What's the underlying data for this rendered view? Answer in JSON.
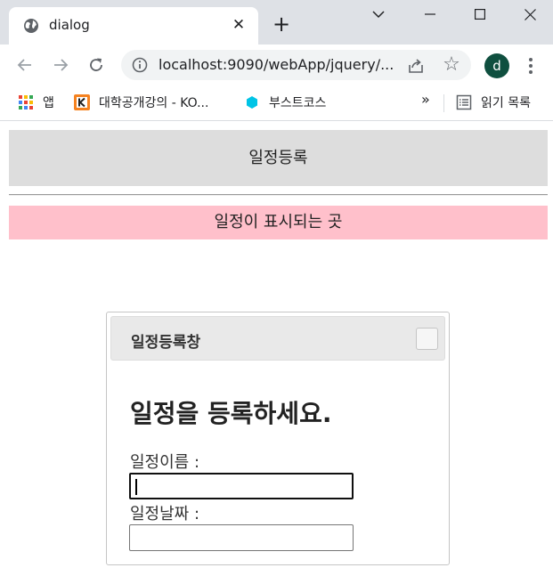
{
  "browser": {
    "tab_title": "dialog",
    "tab_close": "✕",
    "new_tab": "+",
    "url": "localhost:9090/webApp/jquery/...",
    "profile_initial": "d",
    "bookmarks": [
      {
        "label": "앱"
      },
      {
        "label": "대학공개강의 - KO..."
      },
      {
        "label": "부스트코스"
      }
    ],
    "bookmarks_more": "»",
    "reading_list": "읽기 목록"
  },
  "page": {
    "register_button": "일정등록",
    "schedule_area": "일정이 표시되는 곳"
  },
  "dialog": {
    "title": "일정등록창",
    "heading": "일정을 등록하세요.",
    "name_label": "일정이름 :",
    "name_value": "",
    "date_label": "일정날짜 :",
    "date_value": ""
  },
  "colors": {
    "schedule_area_bg": "#ffc0cb",
    "button_bg": "#dddddd",
    "avatar_bg": "#0f4f3f"
  }
}
